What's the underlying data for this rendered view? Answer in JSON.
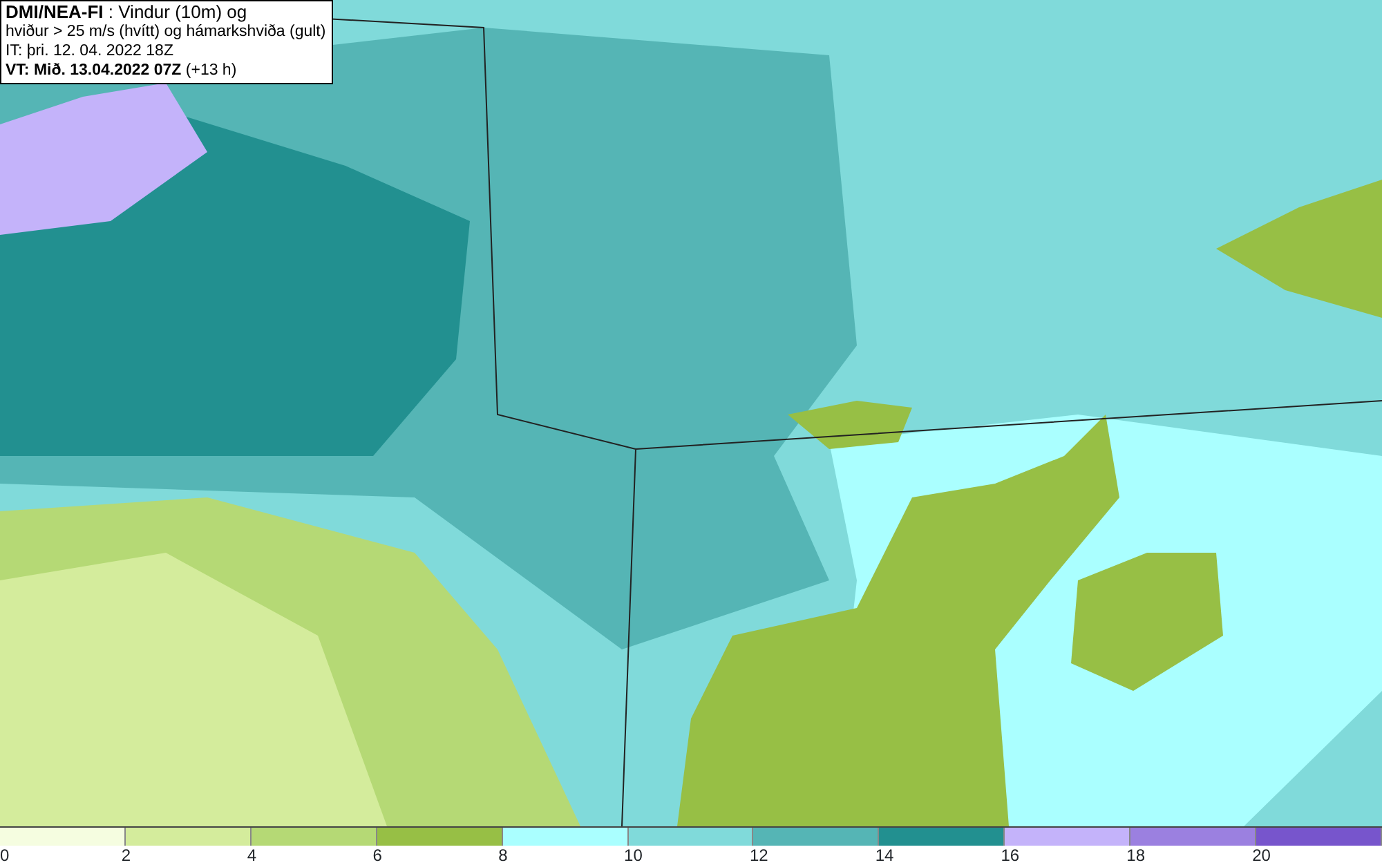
{
  "info_box": {
    "lines": [
      "**DMI/NEA-FI** : Vindur (10m) og",
      "hviður > 25 m/s (hvítt) og hámarkshviða (gult)",
      "IT: þri. 12. 04. 2022 18Z",
      "**VT: Mið. 13.04.2022 07Z** (+13 h)"
    ]
  },
  "legend": {
    "bins": [
      {
        "color": "#f5fde0"
      },
      {
        "color": "#d4ec9c"
      },
      {
        "color": "#b5d975"
      },
      {
        "color": "#97bf45"
      },
      {
        "color": "#aaffff"
      },
      {
        "color": "#80dada"
      },
      {
        "color": "#55b5b5"
      },
      {
        "color": "#229090"
      },
      {
        "color": "#c4b3fa"
      },
      {
        "color": "#9b80e0"
      },
      {
        "color": "#7755cc"
      }
    ],
    "ticks": [
      "0",
      "2",
      "4",
      "6",
      "8",
      "10",
      "12",
      "14",
      "16",
      "18",
      "20"
    ]
  }
}
